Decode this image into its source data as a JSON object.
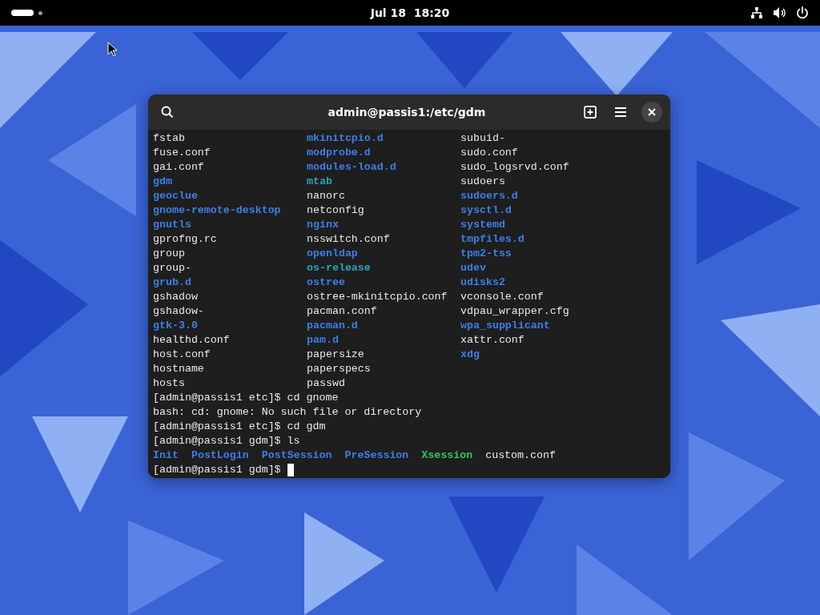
{
  "top_bar": {
    "clock": "Jul 18  18:20"
  },
  "terminal": {
    "title": "admin@passis1:/etc/gdm",
    "ls_columns": [
      [
        {
          "name": "fstab",
          "kind": "file"
        },
        {
          "name": "fuse.conf",
          "kind": "file"
        },
        {
          "name": "gai.conf",
          "kind": "file"
        },
        {
          "name": "gdm",
          "kind": "dir"
        },
        {
          "name": "geoclue",
          "kind": "dir"
        },
        {
          "name": "gnome-remote-desktop",
          "kind": "dir"
        },
        {
          "name": "gnutls",
          "kind": "dir"
        },
        {
          "name": "gprofng.rc",
          "kind": "file"
        },
        {
          "name": "group",
          "kind": "file"
        },
        {
          "name": "group-",
          "kind": "file"
        },
        {
          "name": "grub.d",
          "kind": "dir"
        },
        {
          "name": "gshadow",
          "kind": "file"
        },
        {
          "name": "gshadow-",
          "kind": "file"
        },
        {
          "name": "gtk-3.0",
          "kind": "dir"
        },
        {
          "name": "healthd.conf",
          "kind": "file"
        },
        {
          "name": "host.conf",
          "kind": "file"
        },
        {
          "name": "hostname",
          "kind": "file"
        },
        {
          "name": "hosts",
          "kind": "file"
        }
      ],
      [
        {
          "name": "mkinitcpio.d",
          "kind": "dir"
        },
        {
          "name": "modprobe.d",
          "kind": "dir"
        },
        {
          "name": "modules-load.d",
          "kind": "dir"
        },
        {
          "name": "mtab",
          "kind": "link"
        },
        {
          "name": "nanorc",
          "kind": "file"
        },
        {
          "name": "netconfig",
          "kind": "file"
        },
        {
          "name": "nginx",
          "kind": "dir"
        },
        {
          "name": "nsswitch.conf",
          "kind": "file"
        },
        {
          "name": "openldap",
          "kind": "dir"
        },
        {
          "name": "os-release",
          "kind": "link"
        },
        {
          "name": "ostree",
          "kind": "dir"
        },
        {
          "name": "ostree-mkinitcpio.conf",
          "kind": "file"
        },
        {
          "name": "pacman.conf",
          "kind": "file"
        },
        {
          "name": "pacman.d",
          "kind": "dir"
        },
        {
          "name": "pam.d",
          "kind": "dir"
        },
        {
          "name": "papersize",
          "kind": "file"
        },
        {
          "name": "paperspecs",
          "kind": "file"
        },
        {
          "name": "passwd",
          "kind": "file"
        }
      ],
      [
        {
          "name": "subuid-",
          "kind": "file"
        },
        {
          "name": "sudo.conf",
          "kind": "file"
        },
        {
          "name": "sudo_logsrvd.conf",
          "kind": "file"
        },
        {
          "name": "sudoers",
          "kind": "file"
        },
        {
          "name": "sudoers.d",
          "kind": "dir"
        },
        {
          "name": "sysctl.d",
          "kind": "dir"
        },
        {
          "name": "systemd",
          "kind": "dir"
        },
        {
          "name": "tmpfiles.d",
          "kind": "dir"
        },
        {
          "name": "tpm2-tss",
          "kind": "dir"
        },
        {
          "name": "udev",
          "kind": "dir"
        },
        {
          "name": "udisks2",
          "kind": "dir"
        },
        {
          "name": "vconsole.conf",
          "kind": "file"
        },
        {
          "name": "vdpau_wrapper.cfg",
          "kind": "file"
        },
        {
          "name": "wpa_supplicant",
          "kind": "dir"
        },
        {
          "name": "xattr.conf",
          "kind": "file"
        },
        {
          "name": "xdg",
          "kind": "dir"
        }
      ]
    ],
    "lines": [
      "[admin@passis1 etc]$ cd gnome",
      "bash: cd: gnome: No such file or directory",
      "[admin@passis1 etc]$ cd gdm",
      "[admin@passis1 gdm]$ ls"
    ],
    "gdm_listing": [
      {
        "name": "Init",
        "kind": "dir"
      },
      {
        "name": "PostLogin",
        "kind": "dir"
      },
      {
        "name": "PostSession",
        "kind": "dir"
      },
      {
        "name": "PreSession",
        "kind": "dir"
      },
      {
        "name": "Xsession",
        "kind": "exec"
      },
      {
        "name": "custom.conf",
        "kind": "file"
      }
    ],
    "prompt": "[admin@passis1 gdm]$"
  }
}
